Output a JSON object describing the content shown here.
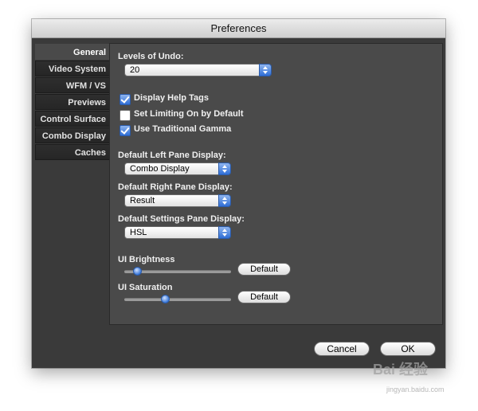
{
  "window": {
    "title": "Preferences"
  },
  "sidebar": {
    "items": [
      {
        "label": "General",
        "active": true
      },
      {
        "label": "Video System"
      },
      {
        "label": "WFM / VS"
      },
      {
        "label": "Previews"
      },
      {
        "label": "Control Surface"
      },
      {
        "label": "Combo Display"
      },
      {
        "label": "Caches"
      }
    ]
  },
  "general": {
    "levels_of_undo": {
      "label": "Levels of Undo:",
      "value": "20"
    },
    "checkboxes": [
      {
        "label": "Display Help Tags",
        "checked": true
      },
      {
        "label": "Set Limiting On by Default",
        "checked": false
      },
      {
        "label": "Use Traditional Gamma",
        "checked": true
      }
    ],
    "left_pane": {
      "label": "Default Left Pane Display:",
      "value": "Combo Display"
    },
    "right_pane": {
      "label": "Default Right Pane Display:",
      "value": "Result"
    },
    "settings_pane": {
      "label": "Default Settings Pane Display:",
      "value": "HSL"
    },
    "ui_brightness": {
      "label": "UI Brightness",
      "value": 0.12,
      "default_label": "Default"
    },
    "ui_saturation": {
      "label": "UI Saturation",
      "value": 0.38,
      "default_label": "Default"
    }
  },
  "footer": {
    "cancel_label": "Cancel",
    "ok_label": "OK"
  },
  "watermark": {
    "text": "Bai 经验",
    "url": "jingyan.baidu.com"
  }
}
